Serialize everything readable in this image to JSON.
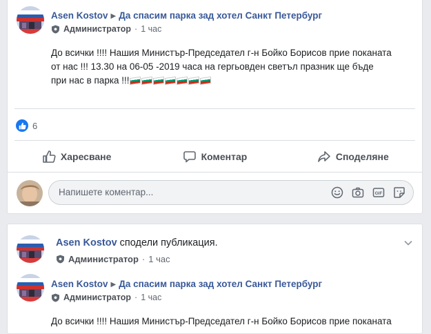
{
  "post1": {
    "author": "Asen Kostov",
    "group": "Да спасим парка зад хотел Санкт Петербург",
    "role": "Администратор",
    "time": "1 час",
    "text_line1": "До всички !!!! Нашия Министър-Председател г-н Бойко Борисов прие поканата",
    "text_line2": "от нас !!! 13.30 на 06-05 -2019 часа на гергьовден светъл празник ще бъде",
    "text_line3": "при нас в парка !!!",
    "flag_count": 7,
    "like_count": "6",
    "actions": {
      "like": "Харесване",
      "comment": "Коментар",
      "share": "Споделяне"
    },
    "comment_placeholder": "Напишете коментар..."
  },
  "post2": {
    "author": "Asen Kostov",
    "shared_text": "сподели публикация.",
    "role": "Администратор",
    "time": "1 час",
    "inner": {
      "author": "Asen Kostov",
      "group": "Да спасим парка зад хотел Санкт Петербург",
      "role": "Администратор",
      "time": "1 час",
      "text_line1": "До всички !!!! Нашия Министър-Председател г-н Бойко Борисов прие поканата"
    }
  },
  "colors": {
    "link": "#385898",
    "like_blue": "#1877f2",
    "background": "#e9ebee"
  },
  "icons": [
    "shield-icon",
    "like-icon",
    "comment-icon",
    "share-icon",
    "emoji-icon",
    "camera-icon",
    "gif-icon",
    "sticker-icon",
    "chevron-down-icon"
  ]
}
